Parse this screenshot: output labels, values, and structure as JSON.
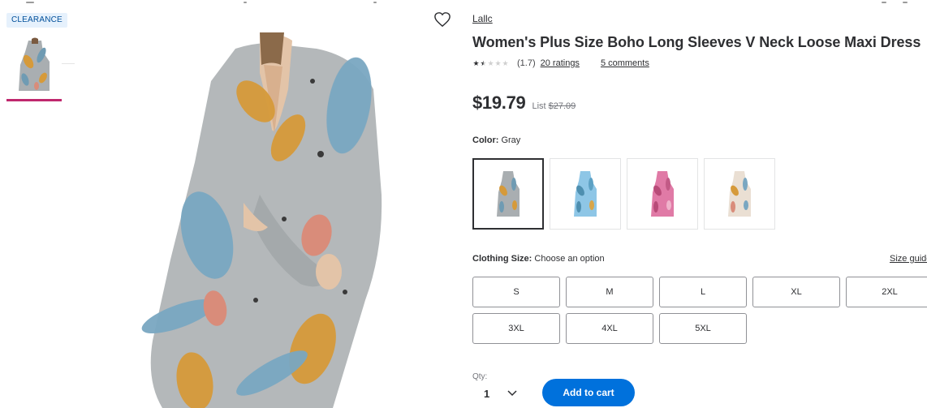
{
  "badge": {
    "label": "CLEARANCE"
  },
  "product": {
    "brand": "Lallc",
    "title": "Women's Plus Size Boho Long Sleeves V Neck Loose Maxi Dress",
    "rating": {
      "value": 1.5,
      "average_text": "(1.7)",
      "ratings_text": "20 ratings",
      "comments_text": "5 comments"
    },
    "price": {
      "current": "$19.79",
      "list_label": "List",
      "list_price": "$27.09"
    }
  },
  "color_option": {
    "label": "Color:",
    "selected": "Gray",
    "swatches": [
      "Gray",
      "Blue",
      "Pink",
      "Beige"
    ]
  },
  "size_option": {
    "label": "Clothing Size:",
    "placeholder": "Choose an option",
    "guide_link": "Size guide",
    "sizes": [
      "S",
      "M",
      "L",
      "XL",
      "2XL",
      "3XL",
      "4XL",
      "5XL"
    ]
  },
  "purchase": {
    "qty_label": "Qty:",
    "qty_value": "1",
    "add_to_cart": "Add to cart"
  },
  "icons": {
    "wishlist": "heart-outline-icon",
    "qty_dropdown": "chevron-down-icon"
  },
  "colors": {
    "accent_blue": "#0071dc",
    "badge_bg": "#e6f1fc",
    "badge_text": "#004f9a",
    "thumb_indicator": "#c0286e",
    "text": "#2e2f32"
  }
}
